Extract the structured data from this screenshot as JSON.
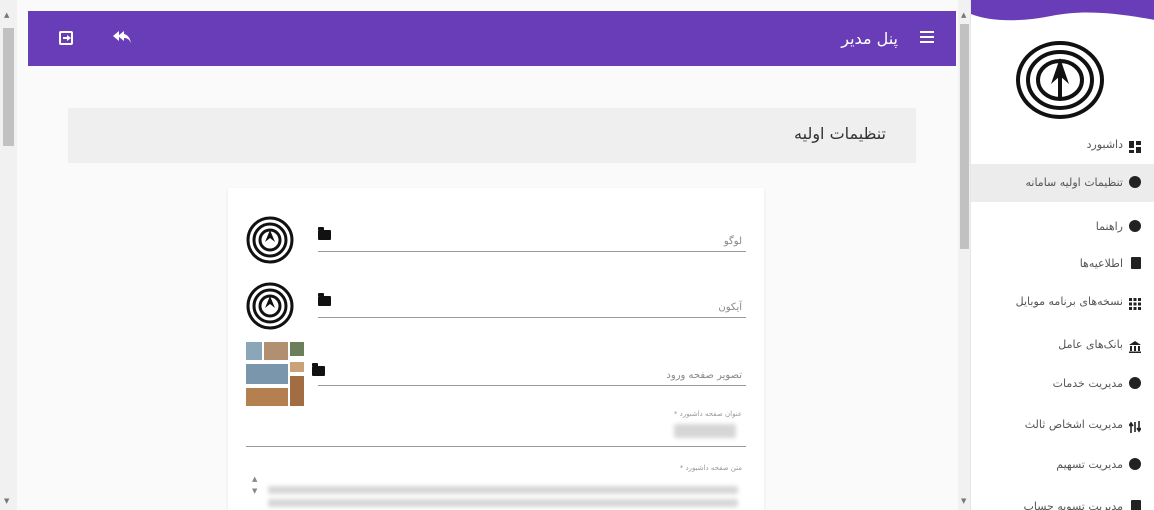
{
  "header": {
    "title": "پنل مدیر",
    "menu_icon": "hamburger-menu-icon",
    "exit_icon": "exit-icon",
    "reply_icon": "reply-all-icon"
  },
  "page": {
    "title": "تنظیمات اولیه"
  },
  "form": {
    "logo_label": "لوگو",
    "icon_label": "آیکون",
    "login_image_label": "تصویر صفحه ورود",
    "dashboard_title_label": "عنوان صفحه داشبورد *",
    "dashboard_text_label": "متن صفحه داشبورد *"
  },
  "sidebar": {
    "items": [
      {
        "label": "داشبورد",
        "icon": "dashboard-icon"
      },
      {
        "label": "تنظیمات اولیه سامانه",
        "icon": "settings-circle-icon"
      },
      {
        "label": "راهنما",
        "icon": "help-icon"
      },
      {
        "label": "اطلاعیه‌ها",
        "icon": "clipboard-icon"
      },
      {
        "label": "نسخه‌های برنامه موبایل",
        "icon": "grid-apps-icon"
      },
      {
        "label": "بانک‌های عامل",
        "icon": "bank-icon"
      },
      {
        "label": "مدیریت خدمات",
        "icon": "services-icon"
      },
      {
        "label": "مدیریت اشخاص ثالث",
        "icon": "third-party-icon"
      },
      {
        "label": "مدیریت تسهیم",
        "icon": "share-icon"
      },
      {
        "label": "مدیریت تسویه حساب",
        "icon": "settlement-icon"
      }
    ],
    "active_index": 1
  },
  "colors": {
    "accent": "#6a3db8",
    "active_item_bg": "#ececec"
  }
}
